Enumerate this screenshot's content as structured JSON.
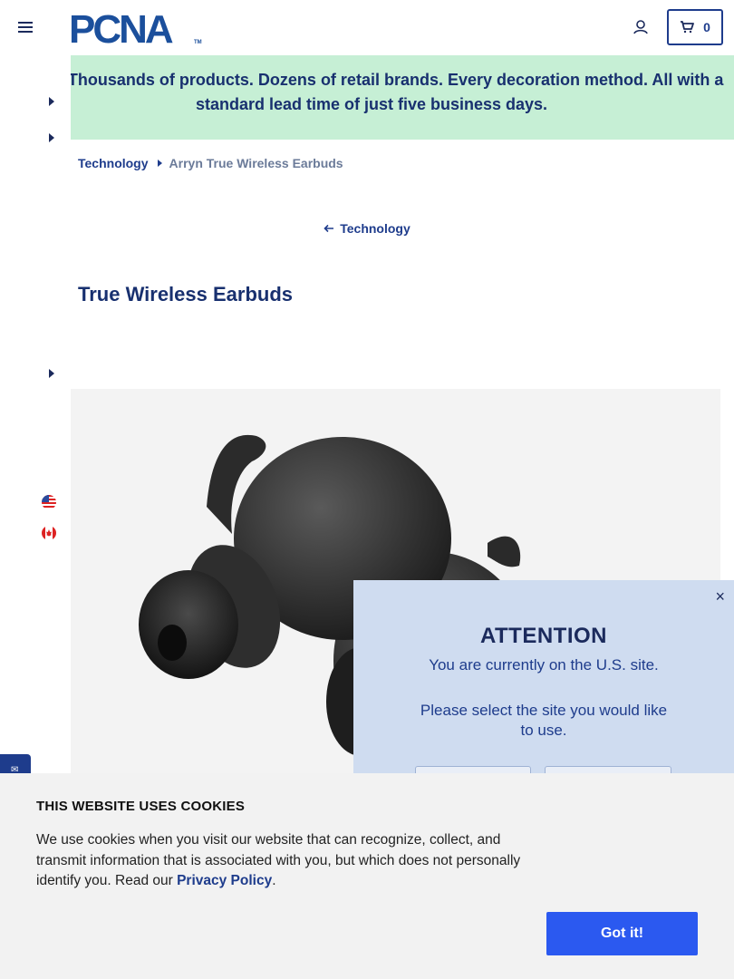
{
  "header": {
    "logo_text": "PCNA",
    "logo_tm": "TM",
    "cart_count": "0",
    "menu_icon": "hamburger-menu-icon",
    "account_icon": "user-account-icon",
    "cart_icon": "shopping-cart-icon"
  },
  "promo": {
    "text": "Wait? Thousands of products. Dozens of retail brands. Every decoration method. All with a standard lead time of just five business days.",
    "background": "#c6efd5"
  },
  "rail": {
    "flags": [
      "us-flag-icon",
      "canada-flag-icon"
    ]
  },
  "breadcrumb": {
    "items": [
      "Technology",
      "Arryn True Wireless Earbuds"
    ]
  },
  "back_link": {
    "label": "Technology"
  },
  "product": {
    "title": "True Wireless Earbuds"
  },
  "attention": {
    "close": "×",
    "title": "ATTENTION",
    "line1": "You are currently on the U.S. site.",
    "line2": "Please select the site you would like to use."
  },
  "cookies": {
    "title": "THIS WEBSITE USES COOKIES",
    "text": "We use cookies when you visit our website that can recognize, collect, and transmit information that is associated with you, but which does not personally identify you. Read our ",
    "link": "Privacy Policy",
    "period": ".",
    "button": "Got it!"
  },
  "colors": {
    "brand": "#1e3c8c",
    "accept_button": "#2b59f0",
    "modal_bg": "#cfdcf0"
  }
}
